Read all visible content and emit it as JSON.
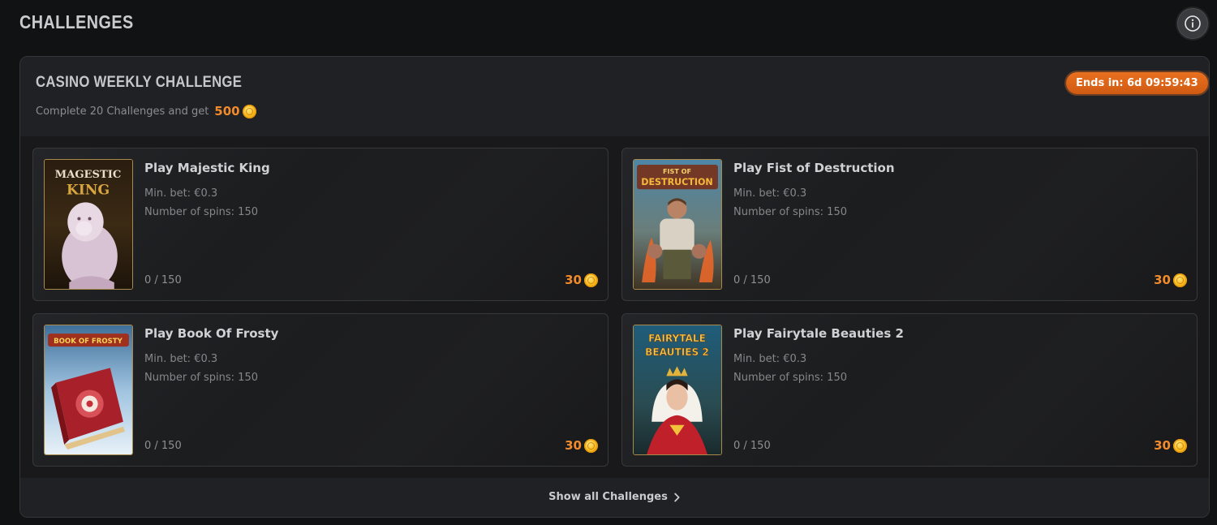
{
  "page": {
    "title": "CHALLENGES"
  },
  "icons": {
    "info": "info-icon",
    "coin": "coin-icon",
    "chevron": "chevron-right-icon"
  },
  "colors": {
    "accent": "#f08a2c",
    "badge": "#e06a1c",
    "background": "#111214"
  },
  "challenge": {
    "title": "CASINO WEEKLY CHALLENGE",
    "subtitle": "Complete 20 Challenges and get",
    "reward": "500",
    "ends": "Ends in: 6d 09:59:43"
  },
  "cards": [
    {
      "game": "Majestic King",
      "title": "Play Majestic King",
      "min_bet": "Min. bet: €0.3",
      "spins": "Number of spins: 150",
      "progress": "0 / 150",
      "progress_value": 0,
      "reward": "30",
      "thumb_text": [
        "MAGESTIC",
        "KING"
      ]
    },
    {
      "game": "Fist of Destruction",
      "title": "Play Fist of Destruction",
      "min_bet": "Min. bet: €0.3",
      "spins": "Number of spins: 150",
      "progress": "0 / 150",
      "progress_value": 0,
      "reward": "30",
      "thumb_text": [
        "FIST OF",
        "DESTRUCTION"
      ]
    },
    {
      "game": "Book Of Frosty",
      "title": "Play Book Of Frosty",
      "min_bet": "Min. bet: €0.3",
      "spins": "Number of spins: 150",
      "progress": "0 / 150",
      "progress_value": 0,
      "reward": "30",
      "thumb_text": [
        "BOOK OF FROSTY"
      ]
    },
    {
      "game": "Fairytale Beauties 2",
      "title": "Play Fairytale Beauties 2",
      "min_bet": "Min. bet: €0.3",
      "spins": "Number of spins: 150",
      "progress": "0 / 150",
      "progress_value": 0,
      "reward": "30",
      "thumb_text": [
        "FAIRYTALE",
        "BEAUTIES 2"
      ]
    }
  ],
  "footer": {
    "show_all": "Show all Challenges"
  }
}
